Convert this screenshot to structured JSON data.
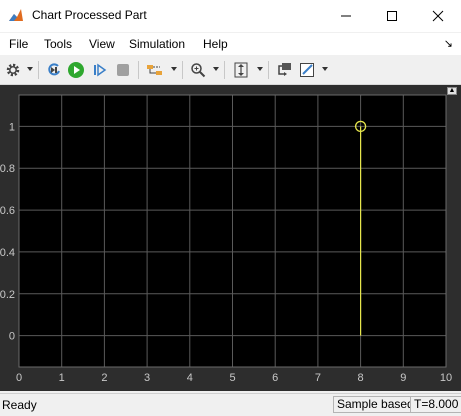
{
  "window": {
    "title": "Chart Processed Part"
  },
  "menu": {
    "items": [
      "File",
      "Tools",
      "View",
      "Simulation",
      "Help"
    ]
  },
  "toolbar": {
    "icons": [
      "gear-icon",
      "step-back-icon",
      "run-icon",
      "step-forward-icon",
      "stop-icon",
      "signal-selector-icon",
      "zoom-icon",
      "scale-axes-icon",
      "highlight-block-icon",
      "style-icon"
    ]
  },
  "colors": {
    "plot_bg": "#000000",
    "frame_bg": "#2d2d2d",
    "grid": "#5a5a5a",
    "signal": "#e6e64c",
    "tick_text": "#c8c8c8",
    "run_green": "#2fa82f"
  },
  "status": {
    "ready": "Ready",
    "mode": "Sample based",
    "time": "T=8.000"
  },
  "chart_data": {
    "type": "scatter",
    "title": "",
    "xlabel": "",
    "ylabel": "",
    "xlim": [
      0,
      10
    ],
    "ylim": [
      -0.15,
      1.15
    ],
    "x_ticks": [
      0,
      1,
      2,
      3,
      4,
      5,
      6,
      7,
      8,
      9,
      10
    ],
    "y_ticks": [
      0,
      0.2,
      0.4,
      0.6,
      0.8,
      1
    ],
    "y_tick_labels": [
      "0",
      "0.2",
      "0.4",
      "0.6",
      "0.8",
      "1"
    ],
    "grid": true,
    "stem": true,
    "series": [
      {
        "x": [
          8
        ],
        "y": [
          1
        ]
      }
    ]
  }
}
